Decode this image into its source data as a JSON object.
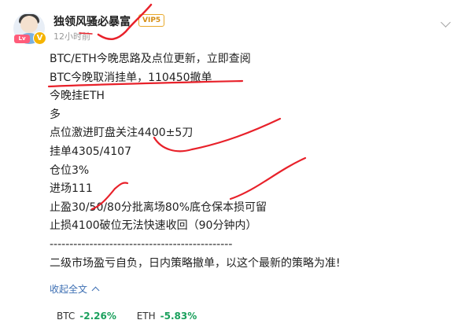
{
  "user": {
    "name": "独领风骚必暴富",
    "vip": "VIP5",
    "level_badge": "Lv",
    "verified_mark": "V"
  },
  "post": {
    "time": "12小时前",
    "lines": [
      "BTC/ETH今晚思路及点位更新，立即查阅",
      "BTC今晚取消挂单，110450撤单",
      "今晚挂ETH",
      "多",
      "点位激进盯盘关注4400±5刀",
      "挂单4305/4107",
      "仓位3%",
      "进场111",
      "止盈30/50/80分批离场80%底仓保本损可留",
      "止损4100破位无法快速收回（90分钟内）",
      "----------------------------------------------",
      "二级市场盈亏自负，日内策略撤单，以这个最新的策略为准!"
    ],
    "collapse_label": "收起全文"
  },
  "tickers": [
    {
      "symbol": "BTC",
      "change": "-2.26%"
    },
    {
      "symbol": "ETH",
      "change": "-5.83%"
    }
  ],
  "colors": {
    "annotation": "#e8212a",
    "positive_ticker": "#1aa05c",
    "link": "#3d6fb3",
    "vip": "#d58d14"
  }
}
